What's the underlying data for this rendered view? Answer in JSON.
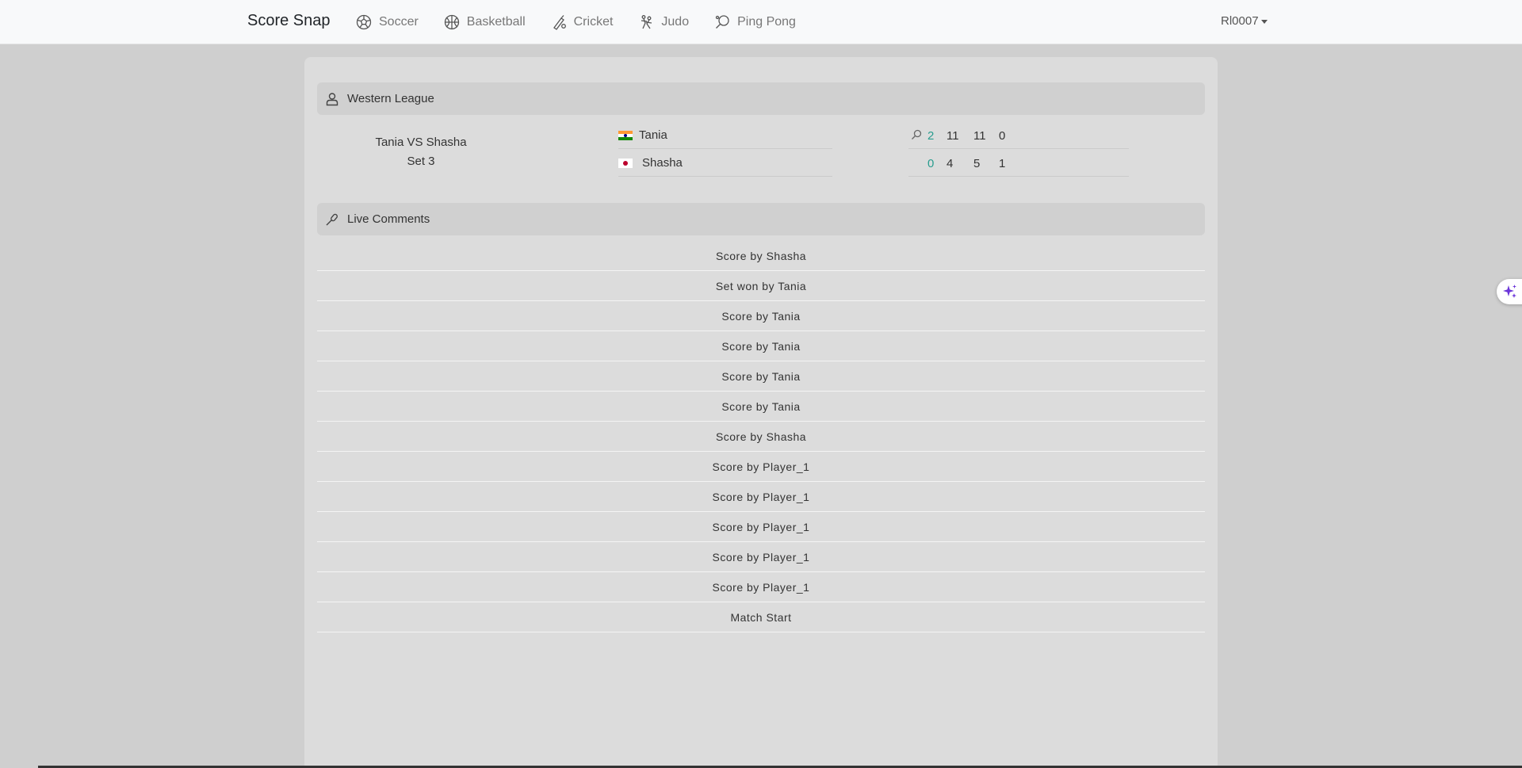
{
  "navbar": {
    "brand": "Score Snap",
    "links": [
      {
        "label": "Soccer",
        "icon": "soccer-ball-icon"
      },
      {
        "label": "Basketball",
        "icon": "basketball-icon"
      },
      {
        "label": "Cricket",
        "icon": "cricket-icon"
      },
      {
        "label": "Judo",
        "icon": "judo-icon"
      },
      {
        "label": "Ping Pong",
        "icon": "ping-pong-paddle-icon"
      }
    ],
    "user": "Rl0007"
  },
  "league": {
    "title": "Western League",
    "icon": "user-icon"
  },
  "match": {
    "title": "Tania VS Shasha",
    "set_label": "Set 3",
    "players": [
      {
        "name": "Tania",
        "flag": "india-flag",
        "sets": "2",
        "games": [
          "11",
          "11",
          "0"
        ],
        "serving": true
      },
      {
        "name": "Shasha",
        "flag": "japan-flag",
        "sets": "0",
        "games": [
          "4",
          "5",
          "1"
        ],
        "serving": false
      }
    ]
  },
  "comments_section": {
    "title": "Live Comments",
    "icon": "microphone-icon",
    "items": [
      "Score by Shasha",
      "Set won by Tania",
      "Score by Tania",
      "Score by Tania",
      "Score by Tania",
      "Score by Tania",
      "Score by Shasha",
      "Score by Player_1",
      "Score by Player_1",
      "Score by Player_1",
      "Score by Player_1",
      "Score by Player_1",
      "Match Start"
    ]
  },
  "colors": {
    "sets_score": "#2a9d8f",
    "ai_button": "#6b35d9"
  }
}
